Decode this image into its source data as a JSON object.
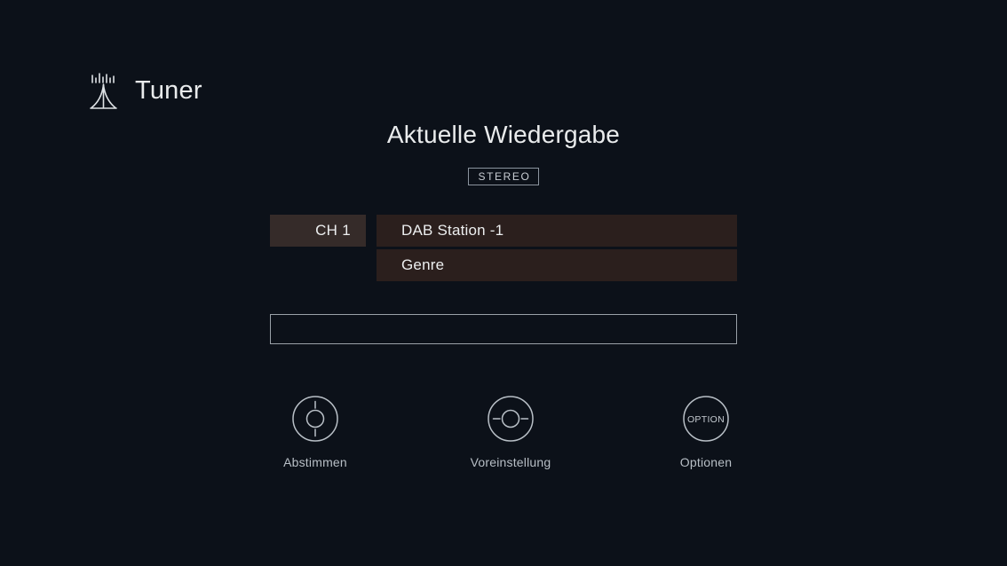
{
  "screen": {
    "background_color": "#0c1119",
    "text_color": "#e9ebec"
  },
  "source_header": {
    "icon": "radio-tower-icon",
    "title": "Tuner"
  },
  "now_playing": {
    "title": "Aktuelle Wiedergabe",
    "audio_mode_badge": "STEREO"
  },
  "station_info": {
    "accent_color": "#352b29",
    "row_color": "#2b1f1d",
    "rows": [
      {
        "channel": "CH 1",
        "value": "DAB Station  -1"
      },
      {
        "channel": "",
        "value": "Genre"
      }
    ]
  },
  "text_field": {
    "value": "",
    "placeholder": "",
    "border_color": "#9aa1a8"
  },
  "controls": [
    {
      "icon": "tune-dial-icon",
      "label": "Abstimmen"
    },
    {
      "icon": "preset-dial-icon",
      "label": "Voreinstellung"
    },
    {
      "icon": "option-button-icon",
      "label": "Optionen",
      "inner_text": "OPTION"
    }
  ]
}
